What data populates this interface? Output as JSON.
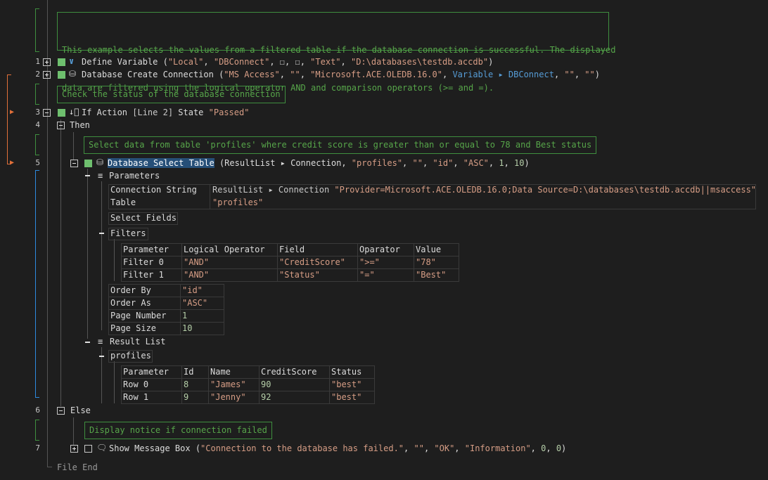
{
  "notes": {
    "intro_1": "This example selects the values from a filtered table if the database connection is successful. The displayed",
    "intro_2": "data are filtered using the logical operator AND and comparison operators (>= and =).",
    "check": "Check the status of the database connection",
    "select": "Select data from table 'profiles' where credit score is greater than or equal to 78 and Best status",
    "notice": "Display notice if connection failed"
  },
  "lines": {
    "l1": {
      "num": "1",
      "cmd": "Define Variable",
      "args": [
        {
          "t": " (",
          "c": "p"
        },
        {
          "t": "\"Local\"",
          "c": "s"
        },
        {
          "t": ", ",
          "c": "p"
        },
        {
          "t": "\"DBConnect\"",
          "c": "s"
        },
        {
          "t": ", ",
          "c": "p"
        },
        {
          "t": "☐",
          "c": "p"
        },
        {
          "t": ", ",
          "c": "p"
        },
        {
          "t": "☐",
          "c": "p"
        },
        {
          "t": ", ",
          "c": "p"
        },
        {
          "t": "\"Text\"",
          "c": "s"
        },
        {
          "t": ", ",
          "c": "p"
        },
        {
          "t": "\"D:\\databases\\testdb.accdb\"",
          "c": "s"
        },
        {
          "t": ")",
          "c": "p"
        }
      ]
    },
    "l2": {
      "num": "2",
      "cmd": "Database Create Connection",
      "args": [
        {
          "t": " (",
          "c": "p"
        },
        {
          "t": "\"MS Access\"",
          "c": "s"
        },
        {
          "t": ", ",
          "c": "p"
        },
        {
          "t": "\"\"",
          "c": "s"
        },
        {
          "t": ", ",
          "c": "p"
        },
        {
          "t": "\"Microsoft.ACE.OLEDB.16.0\"",
          "c": "s"
        },
        {
          "t": ", ",
          "c": "p"
        },
        {
          "t": "Variable ▸ DBConnect",
          "c": "k"
        },
        {
          "t": ", ",
          "c": "p"
        },
        {
          "t": "\"\"",
          "c": "s"
        },
        {
          "t": ", ",
          "c": "p"
        },
        {
          "t": "\"\"",
          "c": "s"
        },
        {
          "t": ")",
          "c": "p"
        }
      ]
    },
    "l3": {
      "num": "3",
      "cmd": "If Action",
      "args": [
        {
          "t": " [Line 2] ",
          "c": "g"
        },
        {
          "t": "State ",
          "c": "p"
        },
        {
          "t": "\"Passed\"",
          "c": "s"
        }
      ]
    },
    "l4": {
      "num": "4",
      "cmd": "Then"
    },
    "l5": {
      "num": "5",
      "cmd": "Database Select Table",
      "args": [
        {
          "t": " (ResultList ▸ Connection, ",
          "c": "p"
        },
        {
          "t": "\"profiles\"",
          "c": "s"
        },
        {
          "t": ", ",
          "c": "p"
        },
        {
          "t": "\"\"",
          "c": "s"
        },
        {
          "t": ", ",
          "c": "p"
        },
        {
          "t": "\"id\"",
          "c": "s"
        },
        {
          "t": ", ",
          "c": "p"
        },
        {
          "t": "\"ASC\"",
          "c": "s"
        },
        {
          "t": ", ",
          "c": "p"
        },
        {
          "t": "1",
          "c": "n"
        },
        {
          "t": ", ",
          "c": "p"
        },
        {
          "t": "10",
          "c": "n"
        },
        {
          "t": ")",
          "c": "p"
        }
      ]
    },
    "l6": {
      "num": "6",
      "cmd": "Else"
    },
    "l7": {
      "num": "7",
      "cmd": "Show Message Box",
      "args": [
        {
          "t": " (",
          "c": "p"
        },
        {
          "t": "\"Connection to the database has failed.\"",
          "c": "s"
        },
        {
          "t": ", ",
          "c": "p"
        },
        {
          "t": "\"\"",
          "c": "s"
        },
        {
          "t": ", ",
          "c": "p"
        },
        {
          "t": "\"OK\"",
          "c": "s"
        },
        {
          "t": ", ",
          "c": "p"
        },
        {
          "t": "\"Information\"",
          "c": "s"
        },
        {
          "t": ", ",
          "c": "p"
        },
        {
          "t": "0",
          "c": "n"
        },
        {
          "t": ", ",
          "c": "p"
        },
        {
          "t": "0",
          "c": "n"
        },
        {
          "t": ")",
          "c": "p"
        }
      ]
    }
  },
  "tree": {
    "parameters": "Parameters",
    "select_fields": "Select Fields",
    "filters": "Filters",
    "result_list": "Result List",
    "profiles": "profiles",
    "file_end": "File End"
  },
  "connection": {
    "rows": [
      {
        "key": "Connection String",
        "value": [
          {
            "t": "ResultList ▸ Connection ",
            "c": "g"
          },
          {
            "t": "\"Provider=Microsoft.ACE.OLEDB.16.0;Data Source=D:\\databases\\testdb.accdb||msaccess\"",
            "c": "s"
          }
        ]
      },
      {
        "key": "Table",
        "value": [
          {
            "t": "\"profiles\"",
            "c": "s"
          }
        ]
      }
    ]
  },
  "filters_table": {
    "headers": [
      "Parameter",
      "Logical Operator",
      "Field",
      "Oparator",
      "Value"
    ],
    "rows": [
      [
        "Filter 0",
        "\"AND\"",
        "\"CreditScore\"",
        "\">=\"",
        "\"78\""
      ],
      [
        "Filter 1",
        "\"AND\"",
        "\"Status\"",
        "\"=\"",
        "\"Best\""
      ]
    ]
  },
  "order_table": {
    "rows": [
      {
        "key": "Order By",
        "value": "\"id\"",
        "kind": "s"
      },
      {
        "key": "Order As",
        "value": "\"ASC\"",
        "kind": "s"
      },
      {
        "key": "Page Number",
        "value": "1",
        "kind": "n"
      },
      {
        "key": "Page Size",
        "value": "10",
        "kind": "n"
      }
    ]
  },
  "result_table": {
    "headers": [
      "Parameter",
      "Id",
      "Name",
      "CreditScore",
      "Status"
    ],
    "rows": [
      [
        "Row 0",
        "8",
        "\"James\"",
        "90",
        "\"best\""
      ],
      [
        "Row 1",
        "9",
        "\"Jenny\"",
        "92",
        "\"best\""
      ]
    ]
  },
  "colors": {
    "background": "#1e1e1e",
    "comment": "#57a64a",
    "string": "#d69d85",
    "keyword": "#569cd6",
    "number": "#b5cea8",
    "selection": "#264f78",
    "marker": "#e2703a",
    "blue_bracket": "#2d8ae0",
    "green_bracket": "#3f8f3f",
    "enabled": "#6ebf6e"
  }
}
